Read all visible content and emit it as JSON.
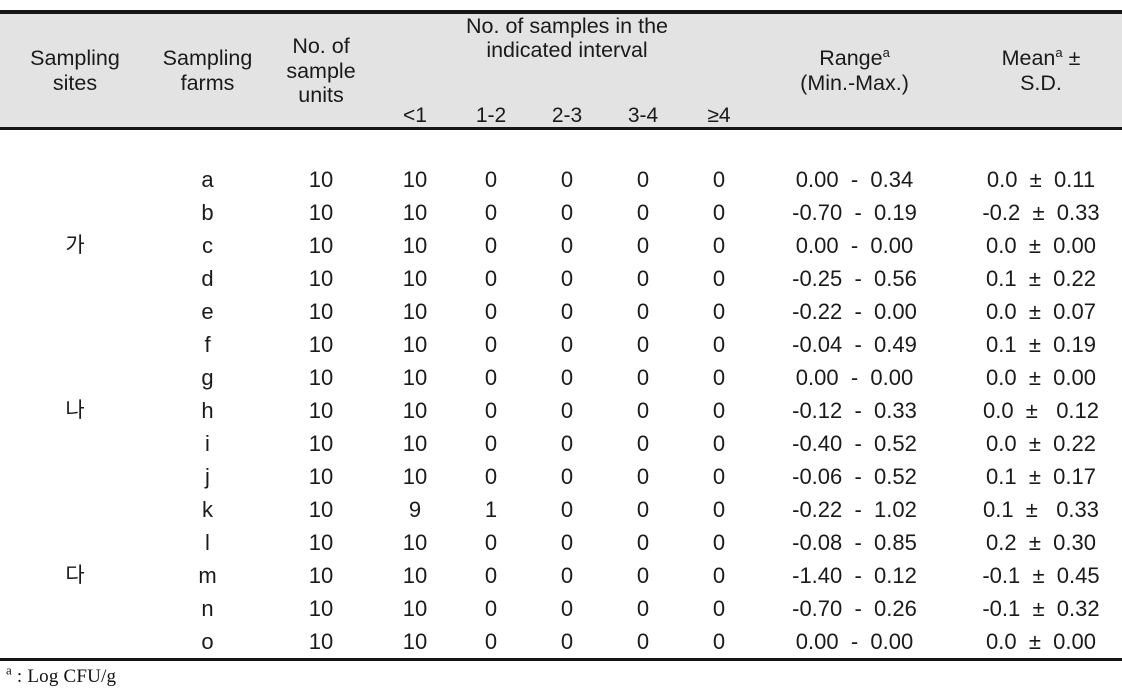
{
  "table": {
    "headers": {
      "sampling_sites": "Sampling\nsites",
      "sampling_sites_line1": "Sampling",
      "sampling_sites_line2": "sites",
      "sampling_farms_line1": "Sampling",
      "sampling_farms_line2": "farms",
      "sample_units_line1": "No. of",
      "sample_units_line2": "sample",
      "sample_units_line3": "units",
      "interval_group_line1": "No. of samples in the",
      "interval_group_line2": "indicated interval",
      "interval_columns": [
        "<1",
        "1-2",
        "2-3",
        "3-4",
        "≥4"
      ],
      "range_line1": "Range",
      "range_sup": "a",
      "range_line2": "(Min.-Max.)",
      "mean_line1": "Mean",
      "mean_sup": "a",
      "mean_pm": " ±",
      "mean_line2": "S.D."
    },
    "rows": [
      {
        "site": "",
        "farm": "a",
        "units": "10",
        "i1": "10",
        "i2": "0",
        "i3": "0",
        "i4": "0",
        "i5": "0",
        "range": "0.00  -  0.34",
        "mean": "0.0  ±  0.11"
      },
      {
        "site": "",
        "farm": "b",
        "units": "10",
        "i1": "10",
        "i2": "0",
        "i3": "0",
        "i4": "0",
        "i5": "0",
        "range": "-0.70  -  0.19",
        "mean": "-0.2  ±  0.33"
      },
      {
        "site": "가",
        "farm": "c",
        "units": "10",
        "i1": "10",
        "i2": "0",
        "i3": "0",
        "i4": "0",
        "i5": "0",
        "range": "0.00  -  0.00",
        "mean": "0.0  ±  0.00"
      },
      {
        "site": "",
        "farm": "d",
        "units": "10",
        "i1": "10",
        "i2": "0",
        "i3": "0",
        "i4": "0",
        "i5": "0",
        "range": "-0.25  -  0.56",
        "mean": "0.1  ±  0.22"
      },
      {
        "site": "",
        "farm": "e",
        "units": "10",
        "i1": "10",
        "i2": "0",
        "i3": "0",
        "i4": "0",
        "i5": "0",
        "range": "-0.22  -  0.00",
        "mean": "0.0  ±  0.07"
      },
      {
        "site": "",
        "farm": "f",
        "units": "10",
        "i1": "10",
        "i2": "0",
        "i3": "0",
        "i4": "0",
        "i5": "0",
        "range": "-0.04  -  0.49",
        "mean": "0.1  ±  0.19"
      },
      {
        "site": "",
        "farm": "g",
        "units": "10",
        "i1": "10",
        "i2": "0",
        "i3": "0",
        "i4": "0",
        "i5": "0",
        "range": "0.00  -  0.00",
        "mean": "0.0  ±  0.00"
      },
      {
        "site": "나",
        "farm": "h",
        "units": "10",
        "i1": "10",
        "i2": "0",
        "i3": "0",
        "i4": "0",
        "i5": "0",
        "range": "-0.12  -  0.33",
        "mean": "0.0  ±   0.12"
      },
      {
        "site": "",
        "farm": "i",
        "units": "10",
        "i1": "10",
        "i2": "0",
        "i3": "0",
        "i4": "0",
        "i5": "0",
        "range": "-0.40  -  0.52",
        "mean": "0.0  ±  0.22"
      },
      {
        "site": "",
        "farm": "j",
        "units": "10",
        "i1": "10",
        "i2": "0",
        "i3": "0",
        "i4": "0",
        "i5": "0",
        "range": "-0.06  -  0.52",
        "mean": "0.1  ±  0.17"
      },
      {
        "site": "",
        "farm": "k",
        "units": "10",
        "i1": "9",
        "i2": "1",
        "i3": "0",
        "i4": "0",
        "i5": "0",
        "range": "-0.22  -  1.02",
        "mean": "0.1  ±   0.33"
      },
      {
        "site": "",
        "farm": "l",
        "units": "10",
        "i1": "10",
        "i2": "0",
        "i3": "0",
        "i4": "0",
        "i5": "0",
        "range": "-0.08  -  0.85",
        "mean": "0.2  ±  0.30"
      },
      {
        "site": "다",
        "farm": "m",
        "units": "10",
        "i1": "10",
        "i2": "0",
        "i3": "0",
        "i4": "0",
        "i5": "0",
        "range": "-1.40  -  0.12",
        "mean": "-0.1  ±  0.45"
      },
      {
        "site": "",
        "farm": "n",
        "units": "10",
        "i1": "10",
        "i2": "0",
        "i3": "0",
        "i4": "0",
        "i5": "0",
        "range": "-0.70  -  0.26",
        "mean": "-0.1  ±  0.32"
      },
      {
        "site": "",
        "farm": "o",
        "units": "10",
        "i1": "10",
        "i2": "0",
        "i3": "0",
        "i4": "0",
        "i5": "0",
        "range": "0.00  -  0.00",
        "mean": "0.0  ±  0.00"
      }
    ],
    "footnote": {
      "sup": "a",
      "text": " :  Log  CFU/g"
    },
    "colors": {
      "header_background": "#e3e3e3",
      "rule": "#161616",
      "text": "#1a1a1a",
      "body_background": "#ffffff"
    }
  }
}
